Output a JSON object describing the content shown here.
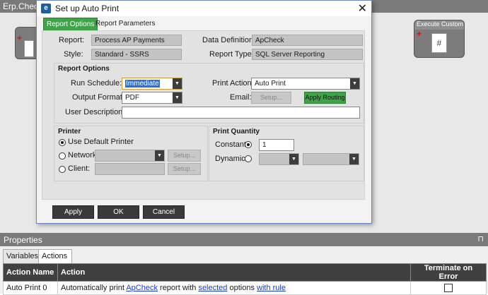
{
  "app": {
    "window_title": "Erp.Check",
    "nodes": {
      "custom_code_title": "Execute Custom Co"
    }
  },
  "dialog": {
    "title": "Set up Auto Print",
    "close_glyph": "✕",
    "tabs": [
      "Report Options",
      "Report Parameters"
    ],
    "report_label": "Report:",
    "report_value": "Process AP Payments",
    "data_definition_label": "Data Definition:",
    "data_definition_value": "ApCheck",
    "style_label": "Style:",
    "style_value": "Standard - SSRS",
    "report_type_label": "Report Type:",
    "report_type_value": "SQL Server Reporting",
    "report_options_title": "Report Options",
    "run_schedule_label": "Run Schedule:",
    "run_schedule_value": "Immediate",
    "print_action_label": "Print Action:",
    "print_action_value": "Auto Print",
    "output_format_label": "Output Format:",
    "output_format_value": "PDF",
    "email_label": "Email:",
    "setup_label": "Setup...",
    "apply_routing_label": "Apply Routing",
    "user_description_label": "User Description:",
    "user_description_value": "",
    "printer_title": "Printer",
    "use_default_printer_label": "Use Default Printer",
    "network_label": "Network",
    "client_label": "Client:",
    "print_quantity_title": "Print Quantity",
    "constant_label": "Constant",
    "constant_value": "1",
    "dynamic_label": "Dynamic",
    "apply_button": "Apply",
    "ok_button": "OK",
    "cancel_button": "Cancel"
  },
  "properties": {
    "title": "Properties",
    "pin_glyph": "📌",
    "tabs": [
      "Variables",
      "Actions"
    ],
    "columns": [
      "Action Name",
      "Action",
      "Terminate on Error"
    ],
    "row": {
      "name": "Auto Print 0",
      "text_1": "Automatically print ",
      "link_1": "ApCheck",
      "text_2": " report with ",
      "link_2": "selected",
      "text_3": " options ",
      "link_3": "with rule"
    }
  },
  "colors": {
    "accent_green": "#3fa447",
    "header_dark": "#404040",
    "link_blue": "#1a3bcc"
  }
}
